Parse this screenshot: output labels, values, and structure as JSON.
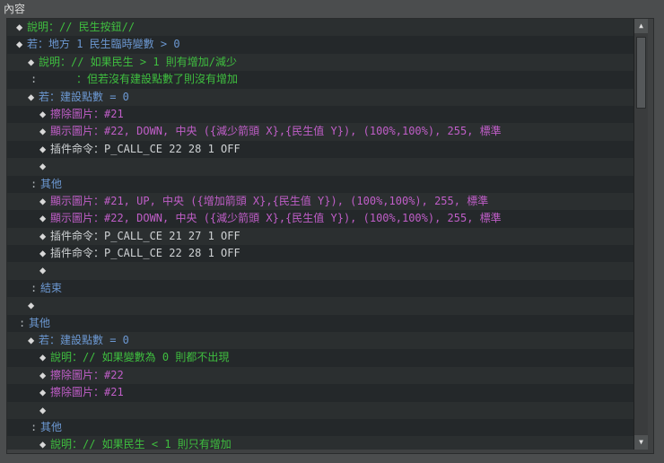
{
  "panel_title": "內容",
  "rows": [
    {
      "indent": 0,
      "kind": "diamond",
      "color": "green",
      "text": "說明：// 民生按鈕//"
    },
    {
      "indent": 0,
      "kind": "diamond",
      "color": "blue",
      "text": "若：地方 1 民生臨時變數 > 0"
    },
    {
      "indent": 1,
      "kind": "diamond",
      "color": "green",
      "text": "說明：// 如果民生 > 1 則有增加/減少"
    },
    {
      "indent": 1,
      "kind": "cont",
      "color": "green",
      "text": "：但若沒有建設點數了則沒有增加"
    },
    {
      "indent": 1,
      "kind": "diamond",
      "color": "blue",
      "text": "若：建設點數 = 0"
    },
    {
      "indent": 2,
      "kind": "diamond",
      "color": "mag",
      "text": "擦除圖片：#21"
    },
    {
      "indent": 2,
      "kind": "diamond",
      "color": "mag",
      "text": "顯示圖片：#22, DOWN, 中央 ({減少箭頭 X},{民生值 Y}), (100%,100%), 255, 標準"
    },
    {
      "indent": 2,
      "kind": "diamond",
      "color": "white",
      "text": "插件命令：P_CALL_CE 22 28 1 OFF"
    },
    {
      "indent": 2,
      "kind": "diamond",
      "color": "white",
      "text": ""
    },
    {
      "indent": 1,
      "kind": "colon",
      "color": "blue",
      "text": "其他"
    },
    {
      "indent": 2,
      "kind": "diamond",
      "color": "mag",
      "text": "顯示圖片：#21, UP, 中央 ({增加箭頭 X},{民生值 Y}), (100%,100%), 255, 標準"
    },
    {
      "indent": 2,
      "kind": "diamond",
      "color": "mag",
      "text": "顯示圖片：#22, DOWN, 中央 ({減少箭頭 X},{民生值 Y}), (100%,100%), 255, 標準"
    },
    {
      "indent": 2,
      "kind": "diamond",
      "color": "white",
      "text": "插件命令：P_CALL_CE 21 27 1 OFF"
    },
    {
      "indent": 2,
      "kind": "diamond",
      "color": "white",
      "text": "插件命令：P_CALL_CE 22 28 1 OFF"
    },
    {
      "indent": 2,
      "kind": "diamond",
      "color": "white",
      "text": ""
    },
    {
      "indent": 1,
      "kind": "colon",
      "color": "blue",
      "text": "結束"
    },
    {
      "indent": 1,
      "kind": "diamond",
      "color": "white",
      "text": ""
    },
    {
      "indent": 0,
      "kind": "colon",
      "color": "blue",
      "text": "其他"
    },
    {
      "indent": 1,
      "kind": "diamond",
      "color": "blue",
      "text": "若：建設點數 = 0"
    },
    {
      "indent": 2,
      "kind": "diamond",
      "color": "green",
      "text": "說明：// 如果變數為 0 則都不出現"
    },
    {
      "indent": 2,
      "kind": "diamond",
      "color": "mag",
      "text": "擦除圖片：#22"
    },
    {
      "indent": 2,
      "kind": "diamond",
      "color": "mag",
      "text": "擦除圖片：#21"
    },
    {
      "indent": 2,
      "kind": "diamond",
      "color": "white",
      "text": ""
    },
    {
      "indent": 1,
      "kind": "colon",
      "color": "blue",
      "text": "其他"
    },
    {
      "indent": 2,
      "kind": "diamond",
      "color": "green",
      "text": "說明：// 如果民生 < 1 則只有增加"
    }
  ],
  "scrollbar": {
    "up_icon": "▲",
    "down_icon": "▼",
    "position_fraction": 0.0
  }
}
